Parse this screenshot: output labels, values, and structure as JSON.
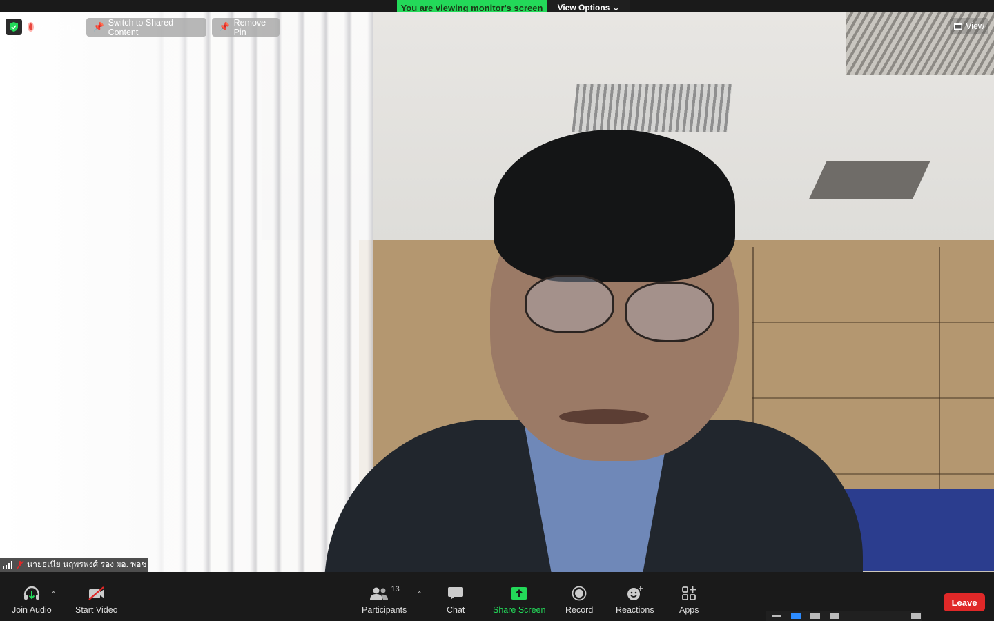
{
  "banner": {
    "text": "You are viewing monitor's screen",
    "view_options": "View Options"
  },
  "overlay": {
    "recording_label": "Recording",
    "switch_shared": "Switch to Shared Content",
    "remove_pin": "Remove Pin",
    "view": "View"
  },
  "participant": {
    "name": "นายธเนีย นฤพรพงศ์ รอง ผอ. พอช"
  },
  "toolbar": {
    "join_audio": "Join Audio",
    "start_video": "Start Video",
    "participants": "Participants",
    "participants_count": "13",
    "chat": "Chat",
    "share_screen": "Share Screen",
    "record": "Record",
    "reactions": "Reactions",
    "apps": "Apps",
    "leave": "Leave"
  },
  "colors": {
    "share_green": "#23d959",
    "leave_red": "#e02828",
    "accent_blue": "#2d8cff"
  }
}
